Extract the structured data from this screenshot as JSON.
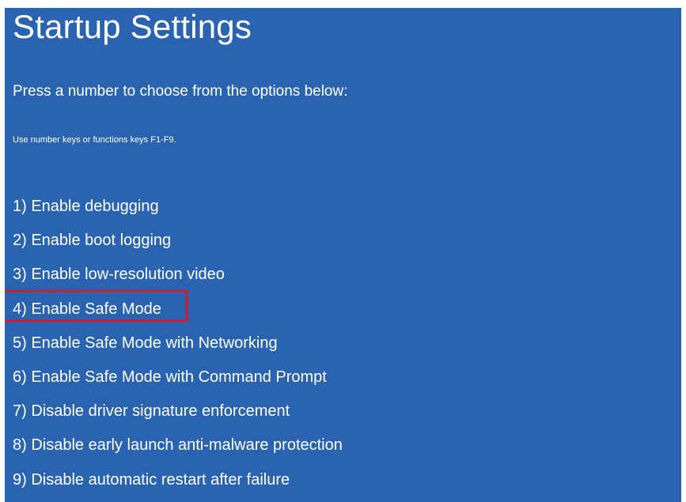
{
  "screen": {
    "title": "Startup Settings",
    "subtitle": "Press a number to choose from the options below:",
    "hint": "Use number keys or functions keys F1-F9.",
    "background_color": "#2a63b0",
    "highlight_color": "#d01c2e",
    "highlighted_option": "4) Enable Safe Mode"
  },
  "options": [
    {
      "label": "1) Enable debugging"
    },
    {
      "label": "2) Enable boot logging"
    },
    {
      "label": "3) Enable low-resolution video"
    },
    {
      "label": "4) Enable Safe Mode"
    },
    {
      "label": "5) Enable Safe Mode with Networking"
    },
    {
      "label": "6) Enable Safe Mode with Command Prompt"
    },
    {
      "label": "7) Disable driver signature enforcement"
    },
    {
      "label": "8) Disable early launch anti-malware protection"
    },
    {
      "label": "9) Disable automatic restart after failure"
    }
  ]
}
